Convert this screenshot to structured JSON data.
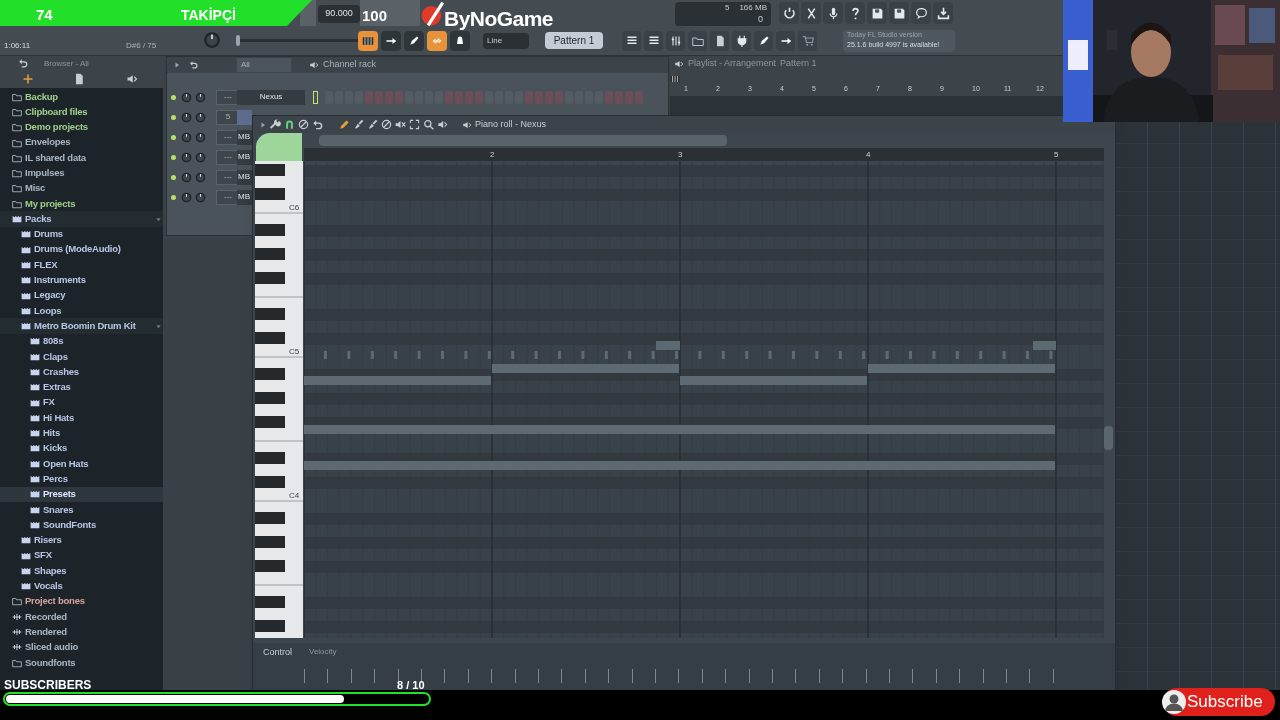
{
  "stream_overlay": {
    "followers": {
      "count": "74",
      "label": "TAKİPÇİ"
    },
    "score": "100",
    "logo": "ByNoGame",
    "subscribers": {
      "label": "SUBSCRIBERS",
      "progress": "8 / 10",
      "level": 0.8
    },
    "subscribe_button": "Subscribe"
  },
  "toolbar": {
    "tempo": "90.000",
    "pitch_slider": {
      "level": 0
    },
    "time": "1:06:11",
    "hint": "D#6 / 75",
    "mode_buttons": [
      {
        "on": true
      },
      {
        "on": false
      },
      {
        "on": false
      },
      {
        "on": true
      },
      {
        "on": false
      }
    ],
    "snap": "Line",
    "pattern": "Pattern 1",
    "cpu": "5",
    "memory": "166 MB",
    "polyphony": "0",
    "news": {
      "title": "Today  FL Studio version",
      "text": "25.1.6 build 4997 is available!"
    }
  },
  "browser": {
    "title": "Browser - All",
    "items": [
      {
        "label": "Backup",
        "kind": "folder",
        "color": "#9fd08a",
        "selected": false
      },
      {
        "label": "Clipboard files",
        "kind": "folder",
        "color": "#9fd08a",
        "selected": false
      },
      {
        "label": "Demo projects",
        "kind": "folder",
        "color": "#9fd08a",
        "selected": false
      },
      {
        "label": "Envelopes",
        "kind": "folder",
        "color": "#a9b6c2",
        "selected": false
      },
      {
        "label": "IL shared data",
        "kind": "folder",
        "color": "#a9b6c2",
        "selected": false
      },
      {
        "label": "Impulses",
        "kind": "folder",
        "color": "#a9b6c2",
        "selected": false
      },
      {
        "label": "Misc",
        "kind": "folder",
        "color": "#a9b6c2",
        "selected": false
      },
      {
        "label": "My projects",
        "kind": "folder",
        "color": "#9fd08a",
        "selected": false
      },
      {
        "label": "Packs",
        "kind": "pack",
        "color": "#b9c6e6",
        "selected": false,
        "expanded": true,
        "children": [
          {
            "label": "Drums",
            "kind": "pack",
            "color": "#b9c6e6",
            "selected": false
          },
          {
            "label": "Drums (ModeAudio)",
            "kind": "pack",
            "color": "#b9c6e6",
            "selected": false
          },
          {
            "label": "FLEX",
            "kind": "pack",
            "color": "#b9c6e6",
            "selected": false
          },
          {
            "label": "Instruments",
            "kind": "pack",
            "color": "#b9c6e6",
            "selected": false
          },
          {
            "label": "Legacy",
            "kind": "pack",
            "color": "#b9c6e6",
            "selected": false
          },
          {
            "label": "Loops",
            "kind": "pack",
            "color": "#b9c6e6",
            "selected": false
          },
          {
            "label": "Metro Boomin Drum Kit",
            "kind": "pack",
            "color": "#b9c6e6",
            "selected": false,
            "expanded": true,
            "children": [
              {
                "label": "808s",
                "kind": "pack",
                "color": "#b9c6e6",
                "selected": false
              },
              {
                "label": "Claps",
                "kind": "pack",
                "color": "#b9c6e6",
                "selected": false
              },
              {
                "label": "Crashes",
                "kind": "pack",
                "color": "#b9c6e6",
                "selected": false
              },
              {
                "label": "Extras",
                "kind": "pack",
                "color": "#b9c6e6",
                "selected": false
              },
              {
                "label": "FX",
                "kind": "pack",
                "color": "#b9c6e6",
                "selected": false
              },
              {
                "label": "Hi Hats",
                "kind": "pack",
                "color": "#b9c6e6",
                "selected": false
              },
              {
                "label": "Hits",
                "kind": "pack",
                "color": "#b9c6e6",
                "selected": false
              },
              {
                "label": "Kicks",
                "kind": "pack",
                "color": "#b9c6e6",
                "selected": false
              },
              {
                "label": "Open Hats",
                "kind": "pack",
                "color": "#b9c6e6",
                "selected": false
              },
              {
                "label": "Percs",
                "kind": "pack",
                "color": "#b9c6e6",
                "selected": false
              },
              {
                "label": "Presets",
                "kind": "pack",
                "color": "#dfe8ff",
                "selected": true
              },
              {
                "label": "Snares",
                "kind": "pack",
                "color": "#b9c6e6",
                "selected": false
              },
              {
                "label": "SoundFonts",
                "kind": "pack",
                "color": "#b9c6e6",
                "selected": false
              }
            ]
          },
          {
            "label": "Risers",
            "kind": "pack",
            "color": "#b9c6e6",
            "selected": false
          },
          {
            "label": "SFX",
            "kind": "pack",
            "color": "#b9c6e6",
            "selected": false
          },
          {
            "label": "Shapes",
            "kind": "pack",
            "color": "#b9c6e6",
            "selected": false
          },
          {
            "label": "Vocals",
            "kind": "pack",
            "color": "#b9c6e6",
            "selected": false
          }
        ]
      },
      {
        "label": "Project bones",
        "kind": "folder",
        "color": "#d9a3a3",
        "selected": false
      },
      {
        "label": "Recorded",
        "kind": "audio",
        "color": "#a9b6c2",
        "selected": false
      },
      {
        "label": "Rendered",
        "kind": "audio",
        "color": "#a9b6c2",
        "selected": false
      },
      {
        "label": "Sliced audio",
        "kind": "audio",
        "color": "#a9b6c2",
        "selected": false
      },
      {
        "label": "Soundfonts",
        "kind": "folder",
        "color": "#a9b6c2",
        "selected": false
      }
    ]
  },
  "channel_rack": {
    "title": "Channel rack",
    "filter": "All",
    "channels": [
      {
        "number": "---",
        "name": "Nexus",
        "selected": false
      },
      {
        "number": "5",
        "selected": true
      },
      {
        "number": "---",
        "name": "MB",
        "selected": false
      },
      {
        "number": "---",
        "name": "MB",
        "selected": false
      },
      {
        "number": "---",
        "name": "MB",
        "selected": false
      },
      {
        "number": "---",
        "name": "MB",
        "selected": false
      }
    ]
  },
  "playlist": {
    "title": "Playlist - Arrangement",
    "pattern": "Pattern 1",
    "bars": [
      "1",
      "2",
      "3",
      "4",
      "5",
      "6",
      "7",
      "8",
      "9",
      "10",
      "11",
      "12"
    ]
  },
  "piano_roll": {
    "title": "Piano roll - Nexus",
    "snap_on": true,
    "bars": [
      "2",
      "3",
      "4",
      "5"
    ],
    "octaves": [
      "C6",
      "C5",
      "C4"
    ],
    "control": "Control",
    "control_target": "Velocity"
  }
}
